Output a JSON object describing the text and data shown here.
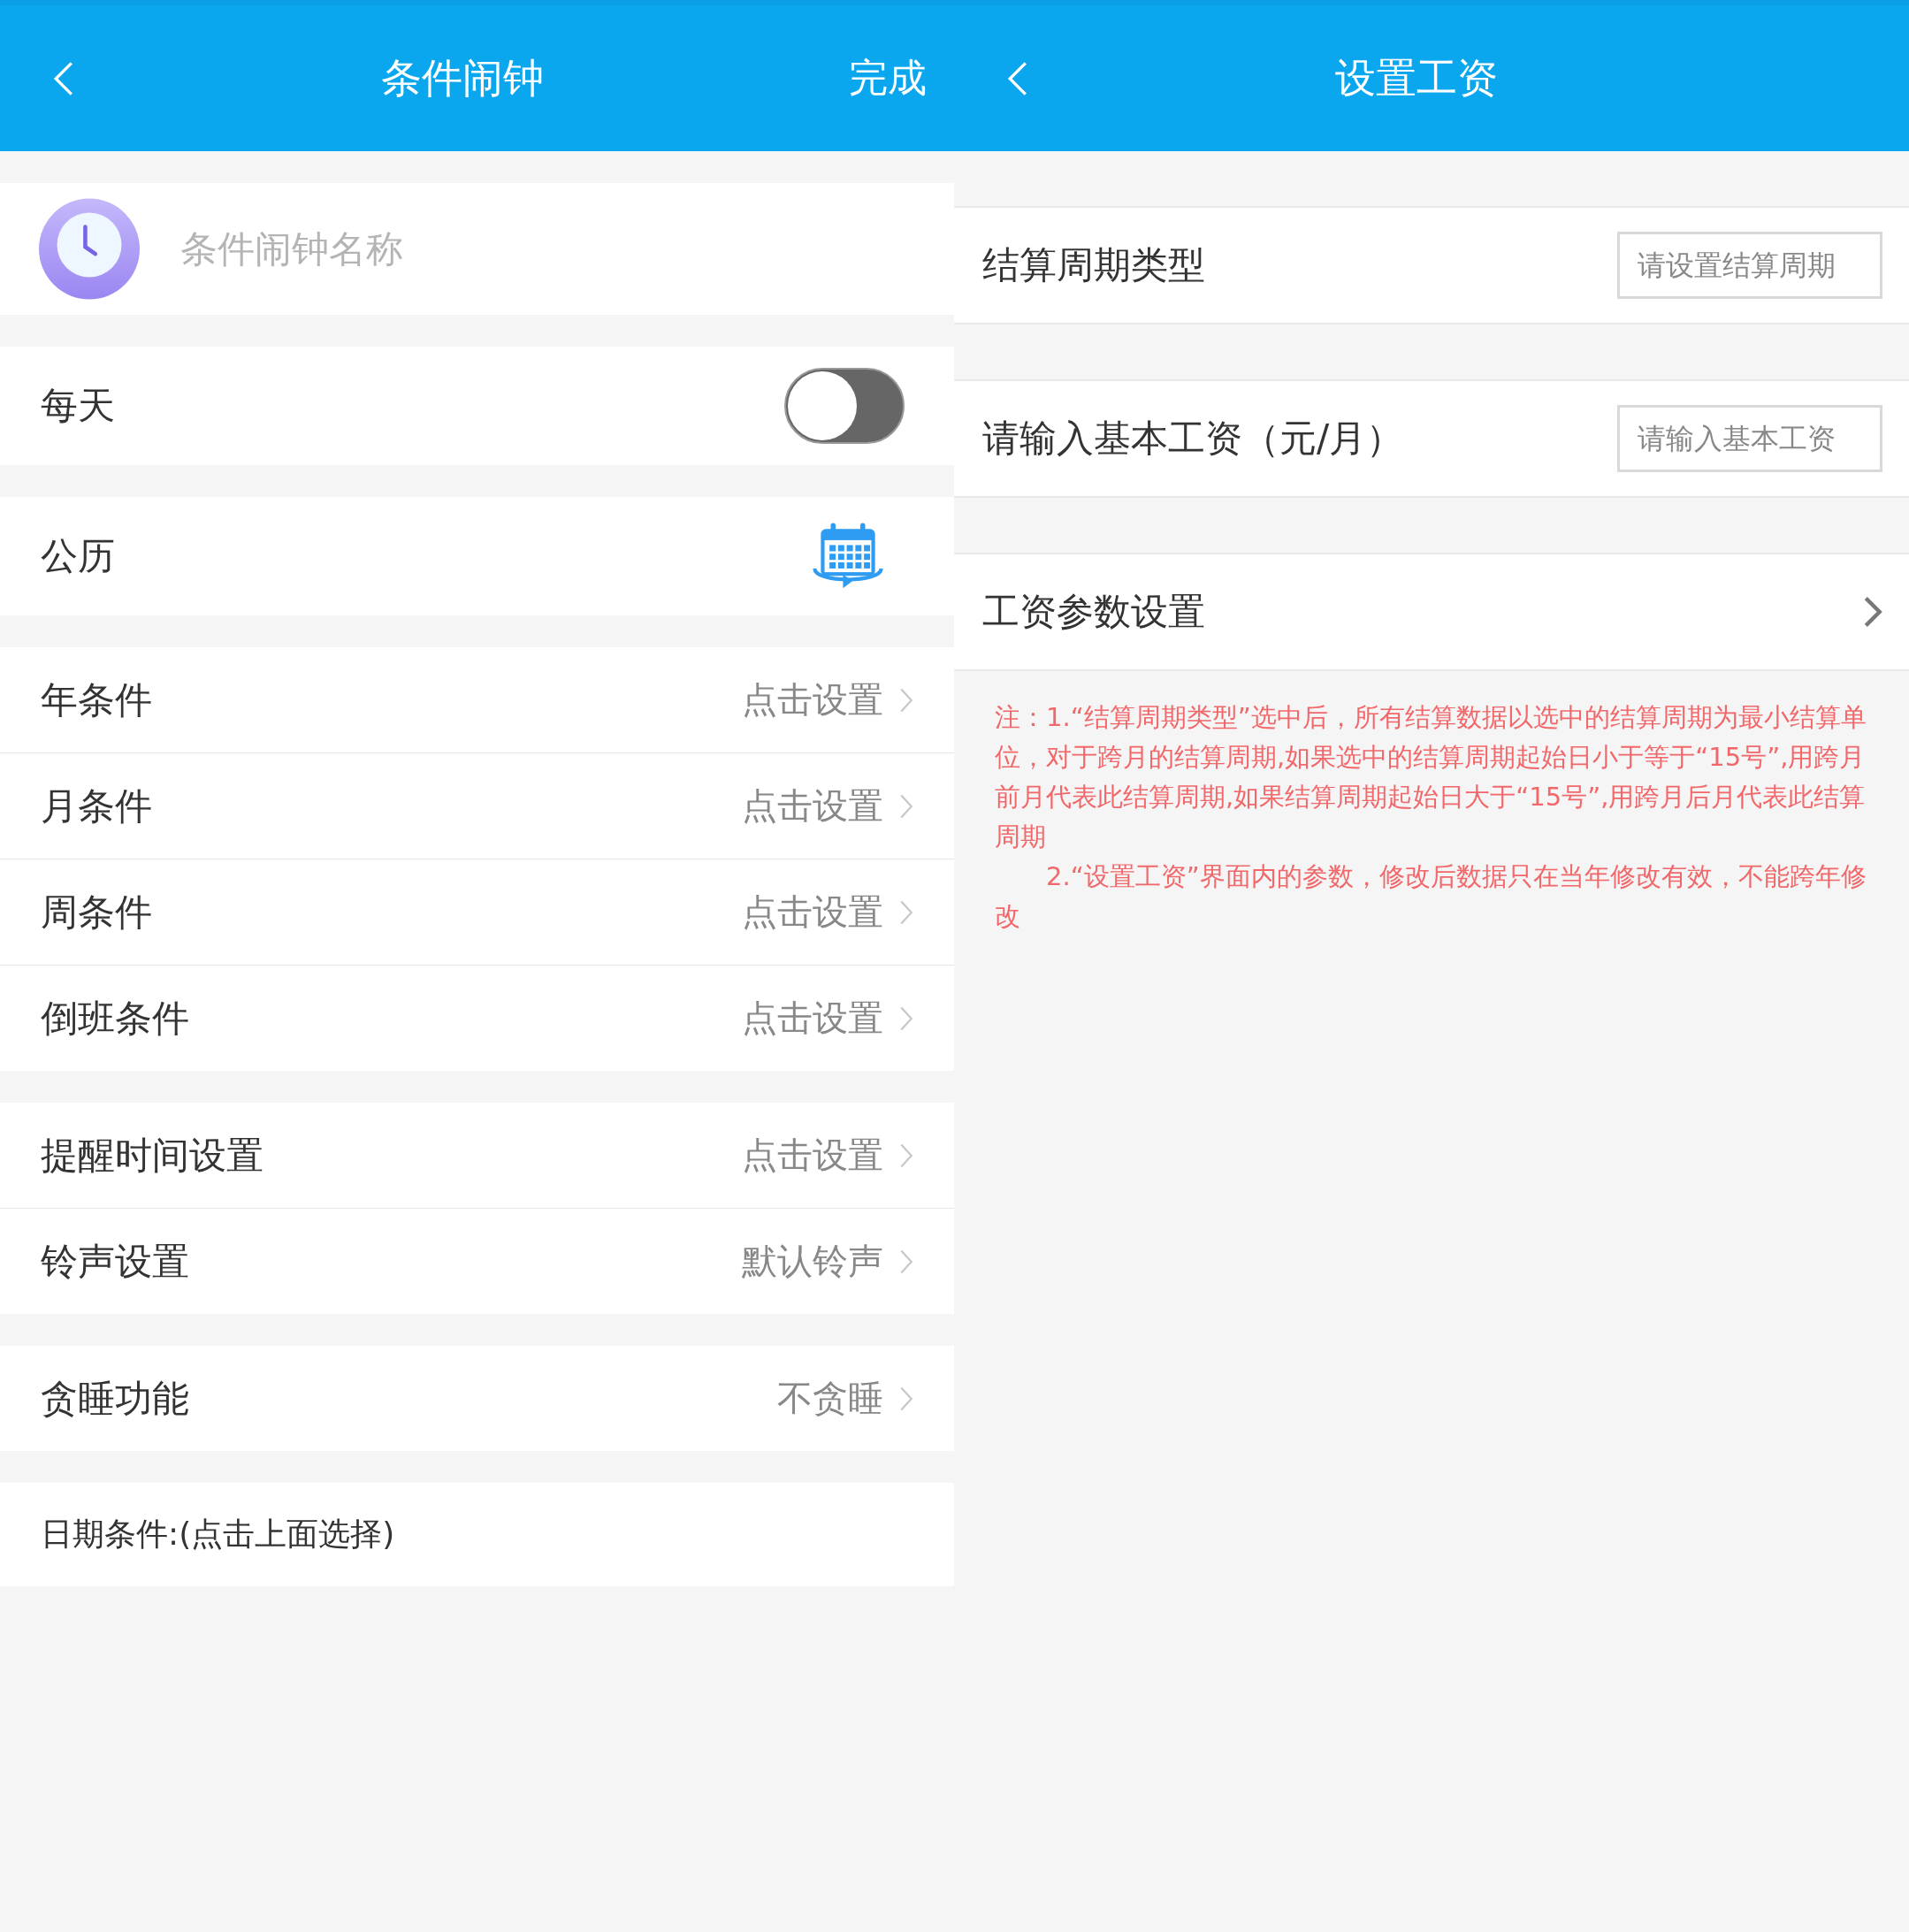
{
  "left": {
    "header": {
      "title": "条件闹钟",
      "action": "完成"
    },
    "name_field": {
      "placeholder": "条件闹钟名称"
    },
    "daily": {
      "label": "每天",
      "on": false
    },
    "calendar": {
      "label": "公历"
    },
    "groups": [
      [
        {
          "label": "年条件",
          "value": "点击设置"
        },
        {
          "label": "月条件",
          "value": "点击设置"
        },
        {
          "label": "周条件",
          "value": "点击设置"
        },
        {
          "label": "倒班条件",
          "value": "点击设置"
        }
      ],
      [
        {
          "label": "提醒时间设置",
          "value": "点击设置"
        },
        {
          "label": "铃声设置",
          "value": "默认铃声"
        }
      ],
      [
        {
          "label": "贪睡功能",
          "value": "不贪睡"
        }
      ]
    ],
    "date_conditions": {
      "label": "日期条件:(点击上面选择)"
    }
  },
  "right": {
    "header": {
      "title": "设置工资"
    },
    "rows": [
      {
        "kind": "field",
        "label": "结算周期类型",
        "placeholder": "请设置结算周期"
      },
      {
        "kind": "field",
        "label": "请输入基本工资（元/月）",
        "placeholder": "请输入基本工资"
      },
      {
        "kind": "link",
        "label": "工资参数设置"
      }
    ],
    "note": [
      "注：1.“结算周期类型”选中后，所有结算数据以选中的结算周期为最小结算单位，对于跨月的结算周期,如果选中的结算周期起始日小于等于“15号”,用跨月前月代表此结算周期,如果结算周期起始日大于“15号”,用跨月后月代表此结算周期",
      "2.“设置工资”界面内的参数，修改后数据只在当年修改有效，不能跨年修改"
    ]
  }
}
